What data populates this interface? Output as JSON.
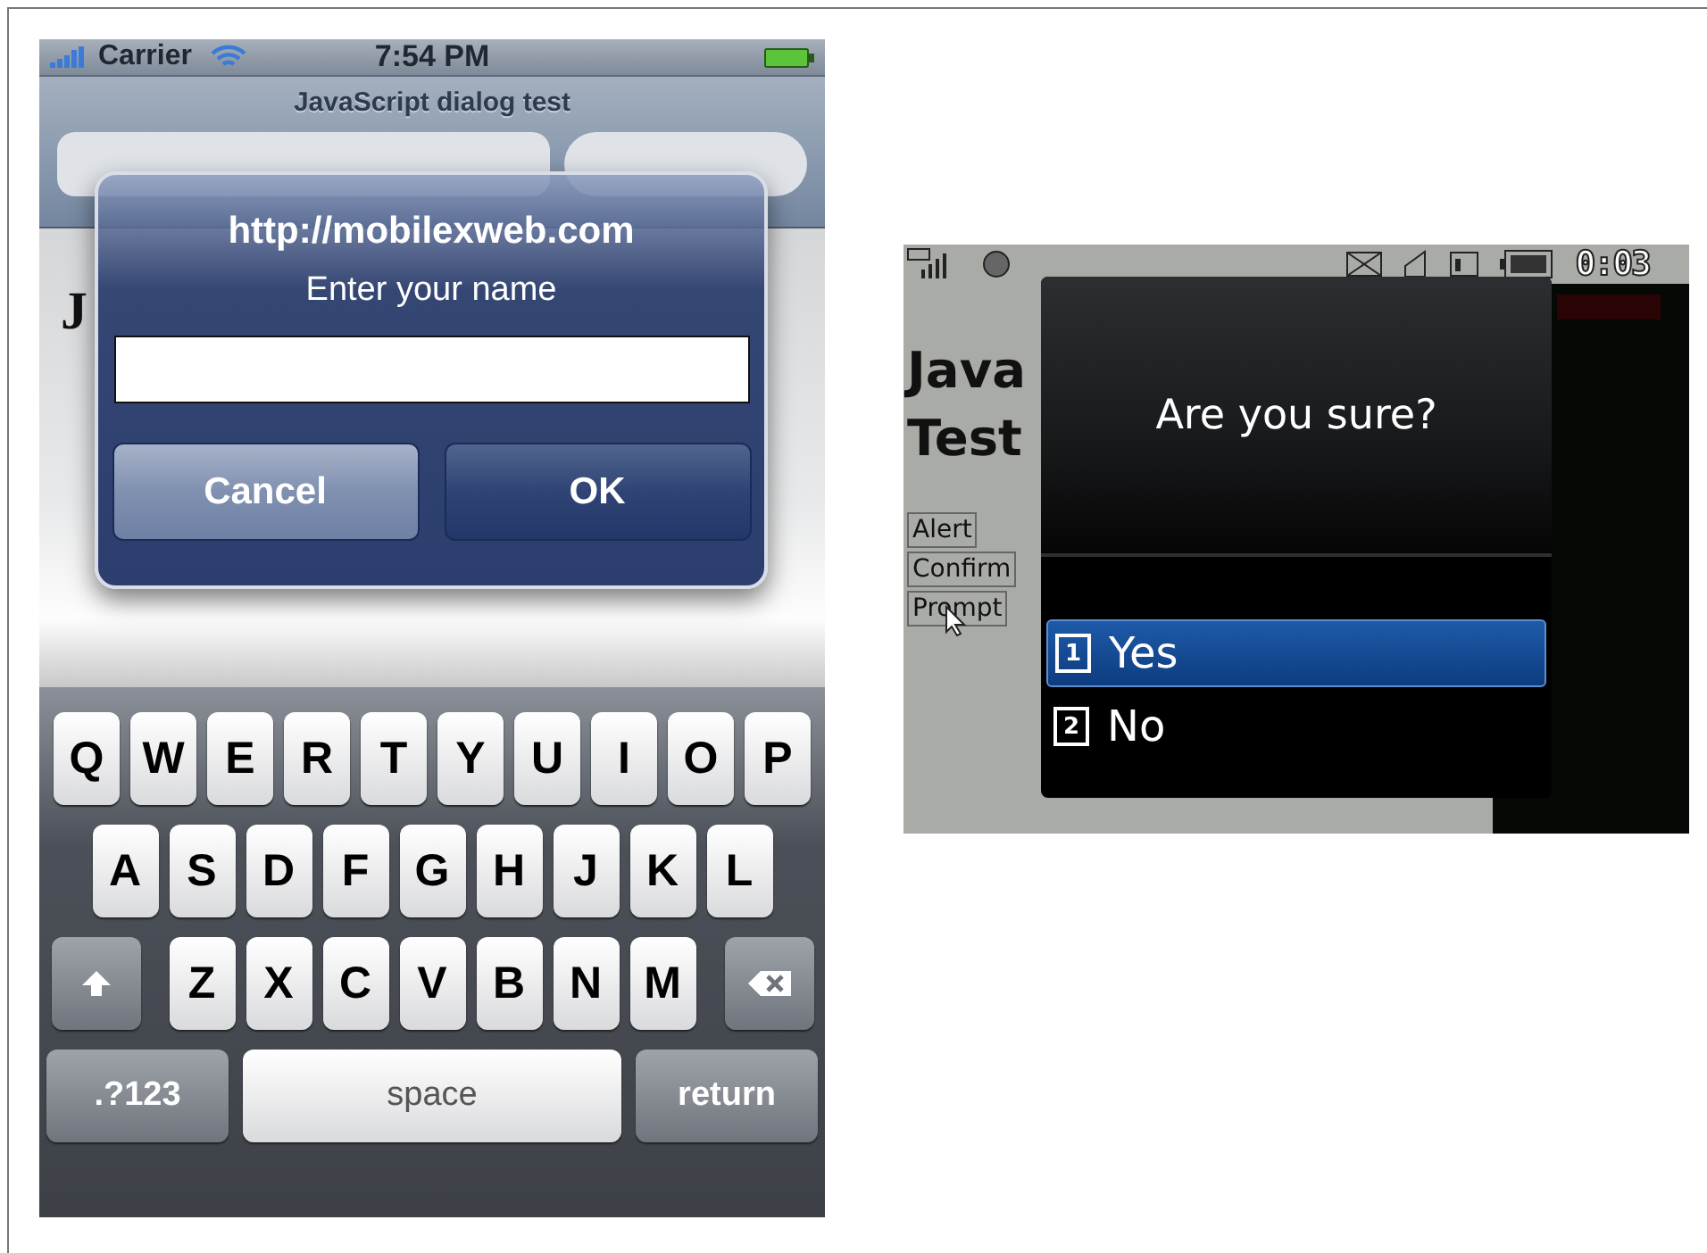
{
  "left_phone": {
    "status_bar": {
      "carrier": "Carrier",
      "time": "7:54 PM"
    },
    "page_title": "JavaScript dialog test",
    "page_heading": "J",
    "dialog": {
      "title": "http://mobilexweb.com",
      "message": "Enter your name",
      "buttons": [
        "Cancel",
        "OK"
      ]
    },
    "keyboard": {
      "rows": [
        [
          "Q",
          "W",
          "E",
          "R",
          "T",
          "Y",
          "U",
          "I",
          "O",
          "P"
        ],
        [
          "A",
          "S",
          "D",
          "F",
          "G",
          "H",
          "J",
          "K",
          "L"
        ],
        [
          "Z",
          "X",
          "C",
          "V",
          "B",
          "N",
          "M"
        ]
      ],
      "bottom_keys": [
        ".?123",
        "space",
        "return"
      ]
    }
  },
  "right_phone": {
    "status_bar": {
      "time": "0:03"
    },
    "page_heading": [
      "Java",
      "Test"
    ],
    "page_buttons": [
      "Alert",
      "Confirm",
      "Prompt"
    ],
    "dialog": {
      "message": "Are you sure?",
      "options": [
        {
          "number": "1",
          "label": "Yes",
          "selected": true
        },
        {
          "number": "2",
          "label": "No",
          "selected": false
        }
      ]
    }
  }
}
